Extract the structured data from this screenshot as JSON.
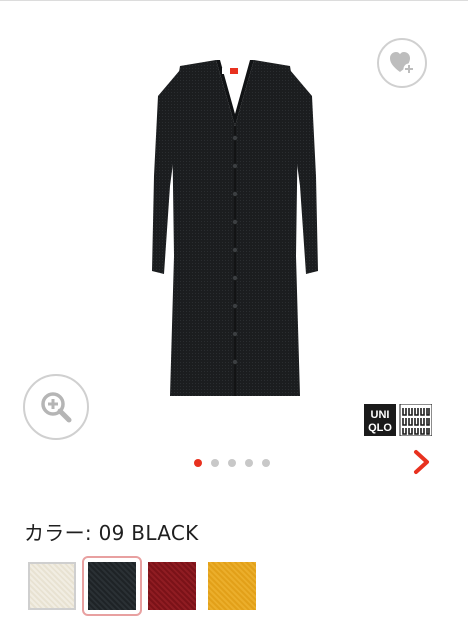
{
  "brand": {
    "logo_text_top": "UNI",
    "logo_text_bottom": "QLO"
  },
  "carousel": {
    "total": 5,
    "active_index": 0
  },
  "color": {
    "label_prefix": "カラー: ",
    "selected_name": "09 BLACK",
    "label": "カラー: 09 BLACK"
  },
  "swatches": [
    {
      "name": "off-white",
      "color": "#f1ede2",
      "selected": false
    },
    {
      "name": "black",
      "color": "#1e2326",
      "selected": true
    },
    {
      "name": "wine",
      "color": "#7b1218",
      "selected": false
    },
    {
      "name": "yellow",
      "color": "#e2a019",
      "selected": false
    }
  ],
  "icons": {
    "wishlist": "heart-plus-icon",
    "zoom": "magnifier-plus-icon",
    "next": "chevron-right-icon"
  },
  "accent_color": "#e8311f"
}
